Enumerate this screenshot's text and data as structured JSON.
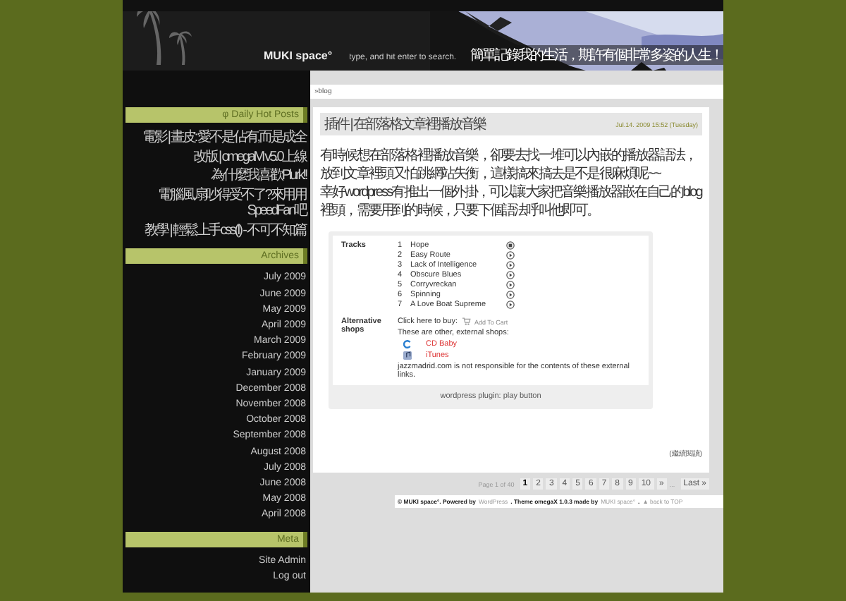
{
  "header": {
    "site_title": "MUKI space°",
    "search": {
      "placeholder": "type, and hit enter to search."
    },
    "tagline": "簡單記錄我的生活，期許有個非常多姿的人生！"
  },
  "breadcrumb": "»blog",
  "sidebar": [
    {
      "title": "Daily Hot Posts",
      "icon": "φ",
      "items": [
        "電影 | 畫皮: 愛不是佔有,而是成全",
        "改版 | omegaM v5.0上線",
        "為什麼我喜歡Plurk!!",
        "電腦風扇吵得受不了?來用用SpeedFan吧",
        "教學 | 輕鬆上手css(I) - 不可不知篇"
      ]
    },
    {
      "title": "Archives",
      "items": [
        "July 2009",
        "June 2009",
        "May 2009",
        "April 2009",
        "March 2009",
        "February 2009",
        "January 2009",
        "December 2008",
        "November 2008",
        "October 2008",
        "September 2008",
        "August 2008",
        "July 2008",
        "June 2008",
        "May 2008",
        "April 2008"
      ]
    },
    {
      "title": "Meta",
      "items": [
        "Site Admin",
        "Log out"
      ]
    }
  ],
  "post": {
    "title": "插件 | 在部落格文章裡播放音樂",
    "date": "Jul.14. 2009 15:52 (Tuesday)",
    "paragraphs": [
      "有時候想在部落格裡播放音樂，卻要去找一堆可以內嵌的播放器語法，放到文章裡頭又怕跳網站失衡，這樣搞來搞去是不是很麻煩呢~~",
      "幸好wordpress有推出一個外掛，可以讓大家把音樂播放器嵌在自己的blog裡頭，需要用到的時候，只要下個語法呼叫他即可。"
    ],
    "player": {
      "tracks_label": "Tracks",
      "tracks": [
        {
          "number": "1",
          "name": "Hope",
          "playing": true
        },
        {
          "number": "2",
          "name": "Easy Route",
          "playing": false
        },
        {
          "number": "3",
          "name": "Lack of Intelligence",
          "playing": false
        },
        {
          "number": "4",
          "name": "Obscure Blues",
          "playing": false
        },
        {
          "number": "5",
          "name": "Corryvreckan",
          "playing": false
        },
        {
          "number": "6",
          "name": "Spinning",
          "playing": false
        },
        {
          "number": "7",
          "name": "A Love Boat Supreme",
          "playing": false
        }
      ],
      "shops_label": "Alternative shops",
      "buy_text": "Click here to buy:",
      "cart_link": "Add To Cart",
      "other_text": "These are other, external shops:",
      "shops": [
        {
          "name": "CD Baby",
          "kind": "cdbaby"
        },
        {
          "name": "iTunes",
          "kind": "itunes"
        }
      ],
      "disclaimer": "jazzmadrid.com is not responsible for the contents of these external links.",
      "caption": "wordpress plugin: play button"
    },
    "more": "(繼續閱讀)"
  },
  "pagination": {
    "label": "Page 1 of 40",
    "pages": [
      {
        "text": "1",
        "selected": true
      },
      {
        "text": "2",
        "selected": false
      },
      {
        "text": "3",
        "selected": false
      },
      {
        "text": "4",
        "selected": false
      },
      {
        "text": "5",
        "selected": false
      },
      {
        "text": "6",
        "selected": false
      },
      {
        "text": "7",
        "selected": false
      },
      {
        "text": "8",
        "selected": false
      },
      {
        "text": "9",
        "selected": false
      },
      {
        "text": "10",
        "selected": false
      },
      {
        "text": "»",
        "selected": false
      }
    ],
    "ellipsis": "...",
    "last": "Last »"
  },
  "footer": [
    {
      "text": "© MUKI space°. Powered by",
      "kind": "text"
    },
    {
      "text": "WordPress",
      "kind": "link"
    },
    {
      "text": ". Theme omegaX 1.0.3 made by",
      "kind": "text"
    },
    {
      "text": "MUKI space°",
      "kind": "link"
    },
    {
      "text": ".",
      "kind": "text"
    },
    {
      "text": "▲ back to TOP",
      "kind": "link"
    }
  ]
}
